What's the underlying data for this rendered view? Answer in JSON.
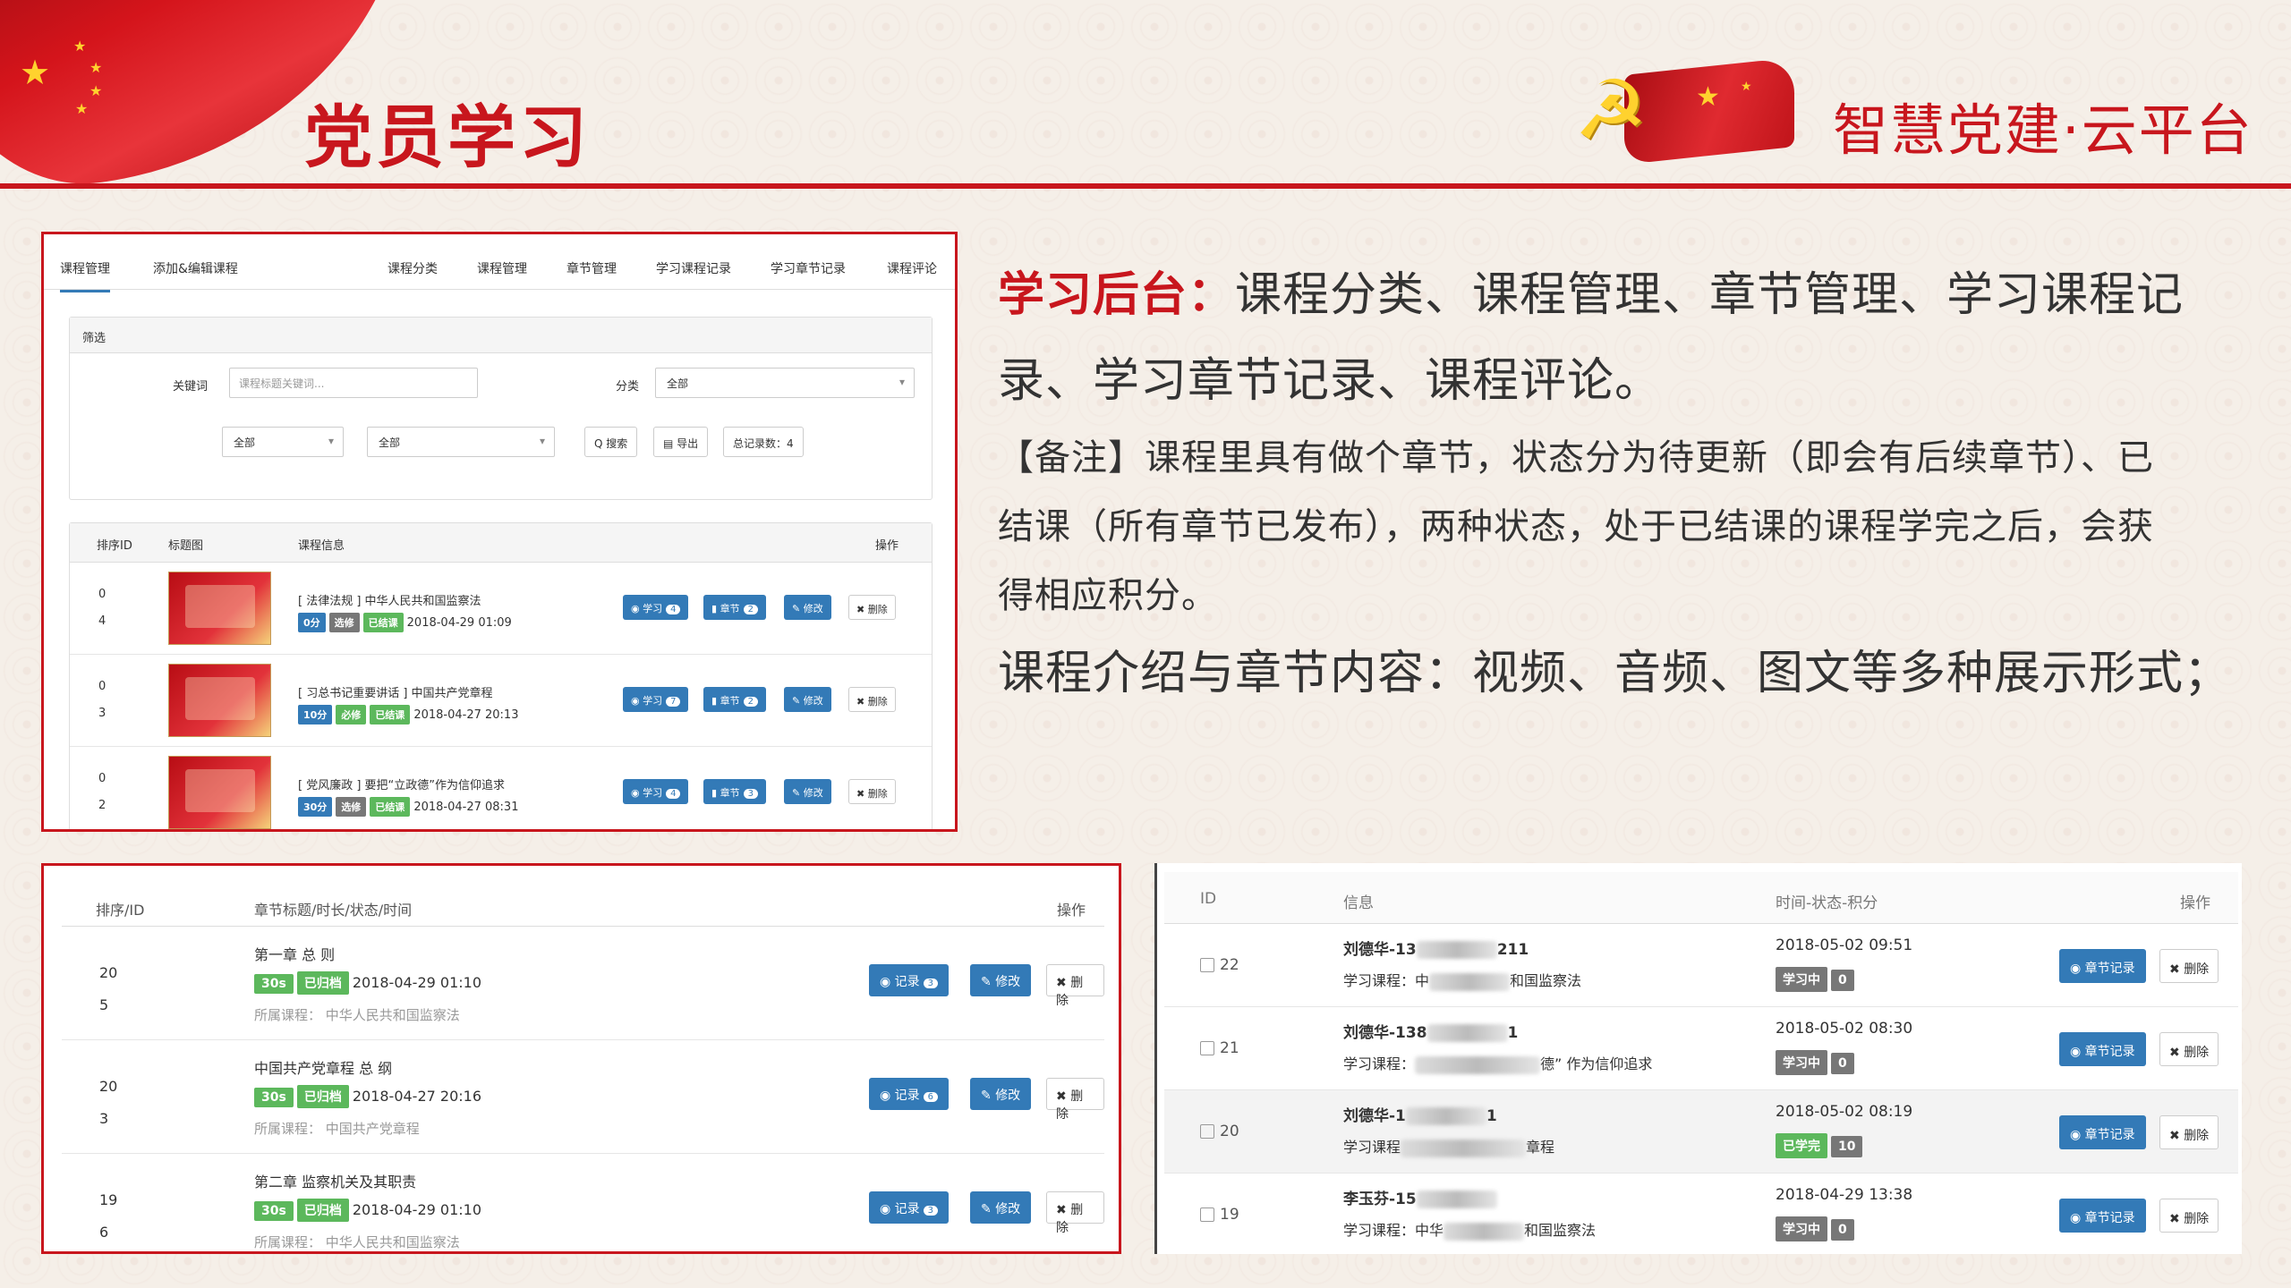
{
  "header": {
    "title_left": "党员学习",
    "title_right": "智慧党建·云平台"
  },
  "description": {
    "line1_lead": "学习后台：",
    "line1_rest": "课程分类、课程管理、章节管理、学习课程记",
    "line2": "录、学习章节记录、课程评论。",
    "note1": "【备注】课程里具有做个章节，状态分为待更新（即会有后续章节）、已",
    "note2": "结课（所有章节已发布），两种状态，处于已结课的课程学完之后，会获",
    "note3": "得相应积分。",
    "line3": "课程介绍与章节内容：视频、音频、图文等多种展示形式；"
  },
  "course_admin": {
    "tabs": [
      "课程管理",
      "添加&编辑课程",
      "课程分类",
      "课程管理",
      "章节管理",
      "学习课程记录",
      "学习章节记录",
      "课程评论"
    ],
    "filter": {
      "heading": "筛选",
      "keyword_label": "关键词",
      "keyword_placeholder": "课程标题关键词...",
      "category_label": "分类",
      "category_value": "全部",
      "select1": "全部",
      "select2": "全部",
      "search_btn": "Q 搜索",
      "export_btn": "导出",
      "total": "总记录数：4"
    },
    "columns": [
      "排序ID",
      "标题图",
      "课程信息",
      "操作"
    ],
    "rows": [
      {
        "sort": "0",
        "id": "4",
        "title": "[ 法律法规 ] 中华人民共和国监察法",
        "score": "0分",
        "type": "选修",
        "status": "已结课",
        "time": "2018-04-29 01:09",
        "study": "4",
        "chapters": "2"
      },
      {
        "sort": "0",
        "id": "3",
        "title": "[ 习总书记重要讲话 ] 中国共产党章程",
        "score": "10分",
        "type": "必修",
        "status": "已结课",
        "time": "2018-04-27 20:13",
        "study": "7",
        "chapters": "2"
      },
      {
        "sort": "0",
        "id": "2",
        "title": "[ 党风廉政 ] 要把“立政德”作为信仰追求",
        "score": "30分",
        "type": "选修",
        "status": "已结课",
        "time": "2018-04-27 08:31",
        "study": "4",
        "chapters": "3"
      }
    ],
    "btn_study": "学习",
    "btn_chapter": "章节",
    "btn_edit": "修改",
    "btn_delete": "删除"
  },
  "chapter_admin": {
    "columns": [
      "排序/ID",
      "章节标题/时长/状态/时间",
      "操作"
    ],
    "rows": [
      {
        "sort": "20",
        "id": "5",
        "title": "第一章 总 则",
        "dur": "30s",
        "status": "已归档",
        "time": "2018-04-29 01:10",
        "course_label": "所属课程：",
        "course": "中华人民共和国监察法",
        "records": "3"
      },
      {
        "sort": "20",
        "id": "3",
        "title": "中国共产党章程 总 纲",
        "dur": "30s",
        "status": "已归档",
        "time": "2018-04-27 20:16",
        "course_label": "所属课程：",
        "course": "中国共产党章程",
        "records": "6"
      },
      {
        "sort": "19",
        "id": "6",
        "title": "第二章 监察机关及其职责",
        "dur": "30s",
        "status": "已归档",
        "time": "2018-04-29 01:10",
        "course_label": "所属课程：",
        "course": "中华人民共和国监察法",
        "records": "3"
      }
    ],
    "btn_record": "记录",
    "btn_edit": "修改",
    "btn_delete": "删除"
  },
  "records_admin": {
    "columns": [
      "ID",
      "信息",
      "时间-状态-积分",
      "操作"
    ],
    "rows": [
      {
        "id": "22",
        "name_pre": "刘德华-13",
        "name_post": "211",
        "course_pre": "学习课程：中",
        "course_post": "和国监察法",
        "time": "2018-05-02 09:51",
        "status": "学习中",
        "points": "0"
      },
      {
        "id": "21",
        "name_pre": "刘德华-138",
        "name_post": "1",
        "course_pre": "学习课程：",
        "course_post": "德” 作为信仰追求",
        "time": "2018-05-02 08:30",
        "status": "学习中",
        "points": "0"
      },
      {
        "id": "20",
        "name_pre": "刘德华-1",
        "name_post": "1",
        "course_pre": "学习课程",
        "course_post": "章程",
        "time": "2018-05-02 08:19",
        "status": "已学完",
        "points": "10"
      },
      {
        "id": "19",
        "name_pre": "李玉芬-15",
        "name_post": "",
        "course_pre": "学习课程：中华",
        "course_post": "和国监察法",
        "time": "2018-04-29 13:38",
        "status": "学习中",
        "points": "0"
      }
    ],
    "btn_record": "章节记录",
    "btn_delete": "删除"
  }
}
